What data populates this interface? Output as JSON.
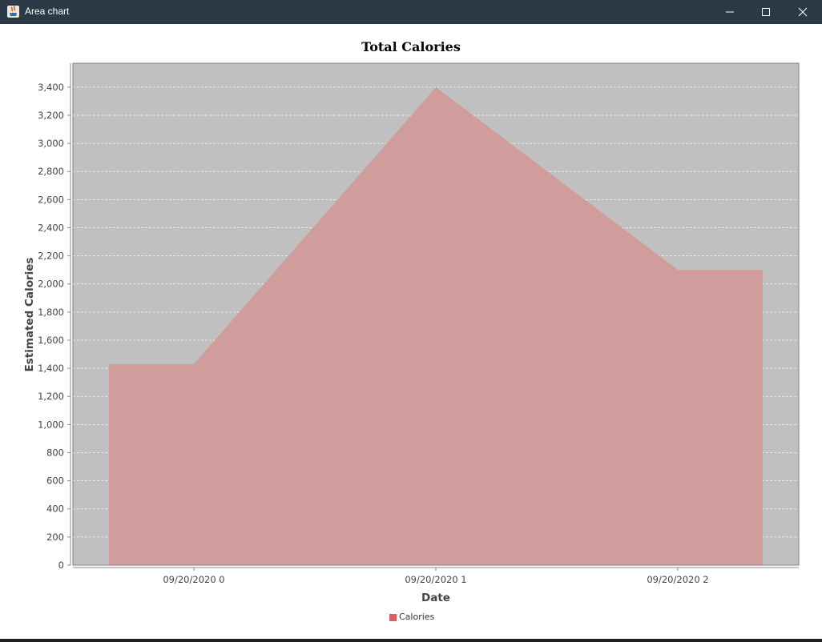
{
  "window": {
    "title": "Area chart"
  },
  "icons": {
    "app": "java-app-icon",
    "minimize": "minimize-icon",
    "maximize": "maximize-icon",
    "close": "close-icon"
  },
  "colors": {
    "plot_background": "#c0c0c0",
    "area_fill": "#d09c9c",
    "legend_swatch": "#d86060",
    "gridline": "#ffffff"
  },
  "chart_data": {
    "type": "area",
    "title": "Total Calories",
    "xlabel": "Date",
    "ylabel": "Estimated Calories",
    "categories": [
      "09/20/2020 0",
      "09/20/2020 1",
      "09/20/2020 2"
    ],
    "series": [
      {
        "name": "Calories",
        "values": [
          1430,
          3400,
          2100
        ]
      }
    ],
    "yticks": [
      "0",
      "200",
      "400",
      "600",
      "800",
      "1,000",
      "1,200",
      "1,400",
      "1,600",
      "1,800",
      "2,000",
      "2,200",
      "2,400",
      "2,600",
      "2,800",
      "3,000",
      "3,200",
      "3,400"
    ],
    "ylim": [
      0,
      3570
    ],
    "grid": true,
    "legend": "bottom-center"
  }
}
